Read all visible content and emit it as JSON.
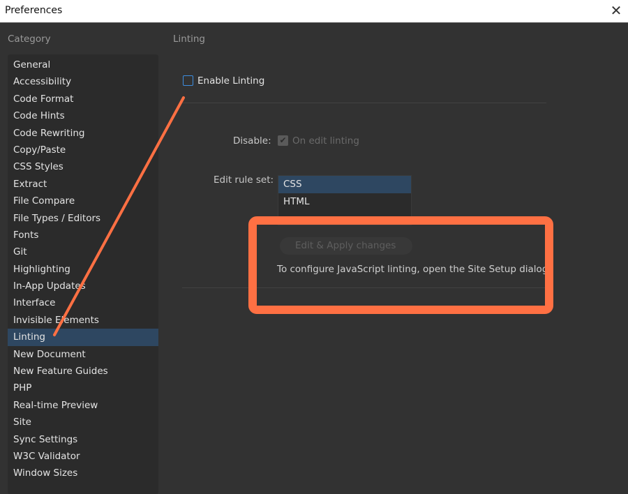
{
  "window": {
    "title": "Preferences",
    "close_icon": "close-icon"
  },
  "sidebar": {
    "label": "Category",
    "selected": "Linting",
    "items": [
      "General",
      "Accessibility",
      "Code Format",
      "Code Hints",
      "Code Rewriting",
      "Copy/Paste",
      "CSS Styles",
      "Extract",
      "File Compare",
      "File Types / Editors",
      "Fonts",
      "Git",
      "Highlighting",
      "In-App Updates",
      "Interface",
      "Invisible Elements",
      "Linting",
      "New Document",
      "New Feature Guides",
      "PHP",
      "Real-time Preview",
      "Site",
      "Sync Settings",
      "W3C Validator",
      "Window Sizes"
    ]
  },
  "main": {
    "section_title": "Linting",
    "enable_linting": {
      "label": "Enable Linting",
      "checked": false
    },
    "disable": {
      "label": "Disable:",
      "option_label": "On edit linting",
      "checked": true,
      "disabled": true
    },
    "rule_set": {
      "label": "Edit rule set:",
      "options": [
        "CSS",
        "HTML"
      ],
      "selected": "CSS"
    },
    "apply_button": "Edit  & Apply changes",
    "js_note": "To configure JavaScript linting, open the Site Setup dialog."
  },
  "annotation": {
    "color": "#ff7043"
  }
}
